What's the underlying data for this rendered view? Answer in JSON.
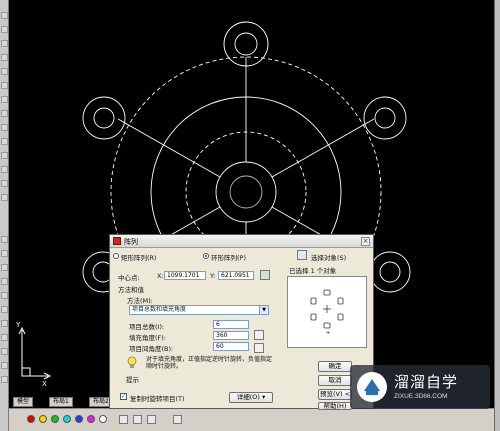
{
  "window": {
    "title": "阵列"
  },
  "dialog": {
    "title": "阵列",
    "close_label": "×",
    "mode_rect": "矩形阵列(R)",
    "mode_polar": "环形阵列(P)",
    "select_objects_label": "选择对象(S)",
    "selected_count": "已选择 1 个对象",
    "center_label": "中心点:",
    "center_x_label": "X:",
    "center_x": "1099.1701",
    "center_y_label": "Y:",
    "center_y": "621.0951",
    "method_group": "方法和值",
    "method_label": "方法(M):",
    "method_value": "项目总数和填充角度",
    "total_items_label": "项目总数(I):",
    "total_items": "6",
    "fill_angle_label": "填充角度(F):",
    "fill_angle": "360",
    "item_angle_label": "项目间角度(B):",
    "item_angle": "60",
    "tip_text": "对于填充角度，正值指定逆时针旋转，负值指定顺时针旋转。",
    "tip_label": "提示",
    "rotate_checkbox": "复制时旋转项目(T)",
    "more_button": "详细(O) ▾",
    "ok_button": "确定",
    "cancel_button": "取消",
    "preview_button": "预览(V) <",
    "help_button": "帮助(H)"
  },
  "bottom_tabs": [
    "模型",
    "布局1",
    "布局2"
  ],
  "colors": {
    "canvas": "#000000",
    "geometry": "#ffffff",
    "dialog_bg": "#ece9d8",
    "app_icon": "#c8281e",
    "chips": [
      "#e00000",
      "#f2d600",
      "#18c018",
      "#16d6d6",
      "#1f3ee6",
      "#e020e0",
      "#ffffff",
      "#888888"
    ]
  },
  "watermark": {
    "title": "溜溜自学",
    "url": "ZIXUE.3D66.COM"
  },
  "icons": {
    "app": "autocad-icon",
    "select": "select-objects-icon",
    "pick_center": "pick-point-icon",
    "tip": "lightbulb-icon"
  }
}
